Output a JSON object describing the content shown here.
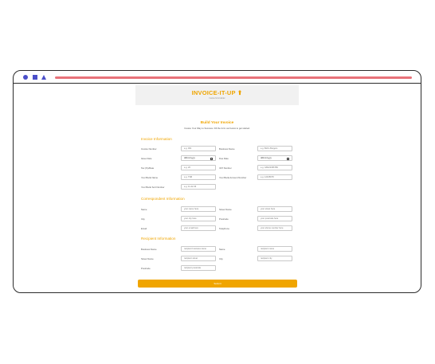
{
  "header": {
    "brand": "INVOICE-IT-UP",
    "tagline": "Invoice form builder"
  },
  "intro": {
    "title": "Build Your Invoice",
    "subtitle": "Invoice Your Way to Success. Fill the form out below to get started."
  },
  "sections": {
    "invoice": "Invoice Information",
    "correspondent": "Correspondent Information",
    "recipient": "Recipient Information"
  },
  "invoice": {
    "invoice_number": {
      "label": "Invoice Number",
      "placeholder": "e.g. 001"
    },
    "business_name": {
      "label": "Business Name",
      "placeholder": "e.g. Bob's Burgers"
    },
    "issue_date": {
      "label": "Issue Date",
      "value": "dd/mm/yyyy"
    },
    "due_date": {
      "label": "Due Date",
      "value": "dd/mm/yyyy"
    },
    "tax_rate": {
      "label": "Tax (%)/Rate",
      "placeholder": "e.g. 20"
    },
    "vat_number": {
      "label": "VAT Number",
      "placeholder": "e.g. GB123456789"
    },
    "bank_name": {
      "label": "Your Bank Name",
      "placeholder": "e.g. TSB"
    },
    "bank_account": {
      "label": "Your Bank Account Number",
      "placeholder": "e.g. 12345678"
    },
    "sort_code": {
      "label": "Your Bank Sort Number",
      "placeholder": "e.g. 11-22-33"
    }
  },
  "correspondent": {
    "name": {
      "label": "Name",
      "placeholder": "your name here"
    },
    "street": {
      "label": "Street Name",
      "placeholder": "your street here"
    },
    "city": {
      "label": "City",
      "placeholder": "your city here"
    },
    "postcode": {
      "label": "Postcode",
      "placeholder": "your postcode here"
    },
    "email": {
      "label": "Email",
      "placeholder": "your email here"
    },
    "telephone": {
      "label": "Telephone",
      "placeholder": "your phone number here"
    }
  },
  "recipient": {
    "business_name": {
      "label": "Business Name",
      "placeholder": "recipient business name"
    },
    "name": {
      "label": "Name",
      "placeholder": "recipient name"
    },
    "street": {
      "label": "Street Name",
      "placeholder": "recipient street"
    },
    "city": {
      "label": "City",
      "placeholder": "recipient city"
    },
    "postcode": {
      "label": "Postcode",
      "placeholder": "recipient postcode"
    }
  },
  "submit_label": "Submit",
  "colors": {
    "accent": "#f0a500",
    "window_icons": "#4b4fc9",
    "address_bar": "#e8727a"
  }
}
